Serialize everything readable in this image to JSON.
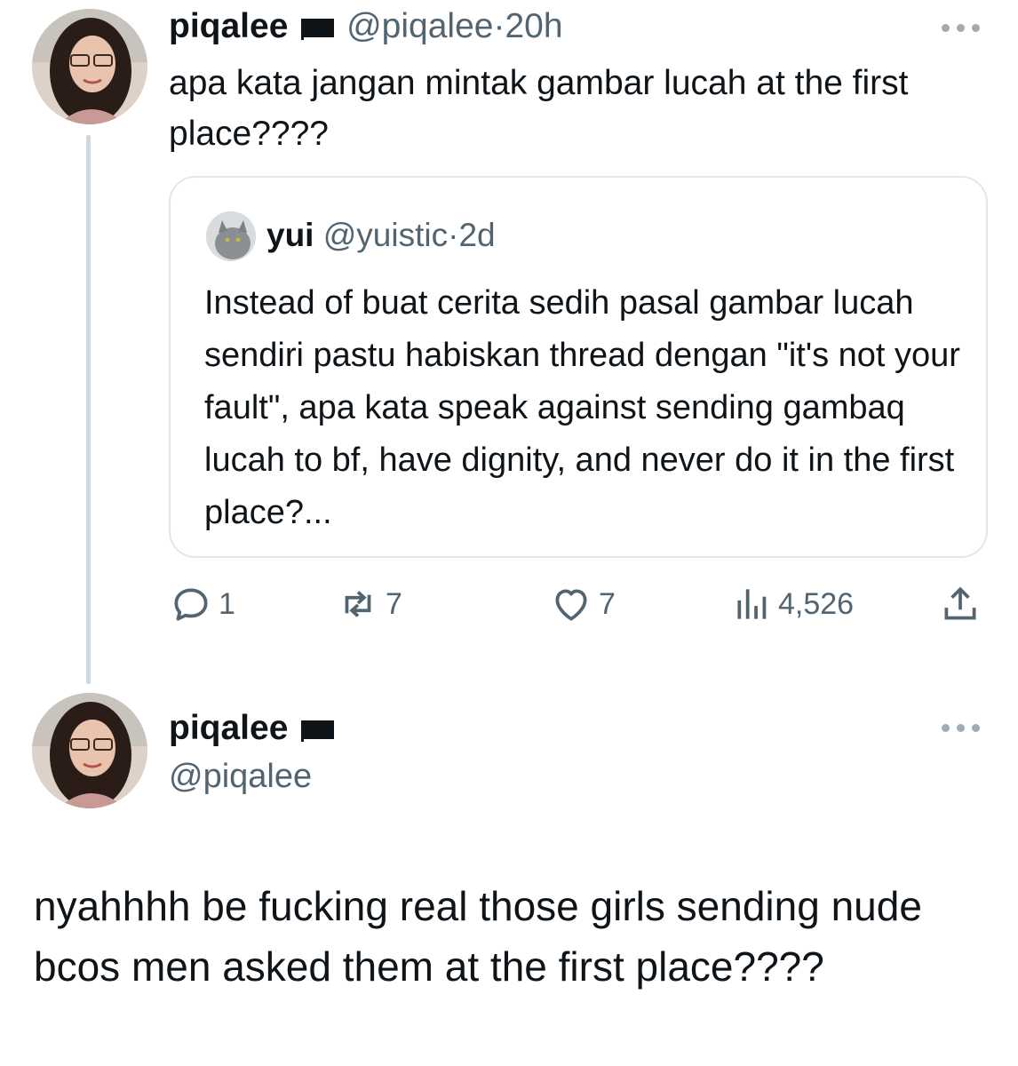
{
  "tweet": {
    "author_name": "piqalee",
    "author_handle": "@piqalee",
    "separator": "·",
    "time": "20h",
    "text": "apa kata jangan mintak gambar lucah at the first place????",
    "quoted": {
      "author_name": "yui",
      "author_handle": "@yuistic",
      "separator": "·",
      "time": "2d",
      "text": "Instead of buat cerita sedih pasal gambar lucah sendiri pastu habiskan thread dengan \"it's not your fault\", apa kata speak against sending gambaq lucah to bf, have dignity, and never do it in the first place?..."
    },
    "stats": {
      "replies": "1",
      "reposts": "7",
      "likes": "7",
      "views": "4,526"
    }
  },
  "reply": {
    "author_name": "piqalee",
    "author_handle": "@piqalee",
    "text": "nyahhhh be fucking real those girls sending nude bcos men asked them at the first place????"
  },
  "icons": {
    "more": "more-horizontal-icon",
    "reply": "reply-icon",
    "repost": "repost-icon",
    "like": "heart-icon",
    "views": "views-chart-icon",
    "share": "share-icon",
    "flag": "black-flag-icon"
  },
  "colors": {
    "text": "#0f1419",
    "muted": "#536471",
    "border": "#e1e8ed",
    "thread_line": "#cfd9de"
  }
}
